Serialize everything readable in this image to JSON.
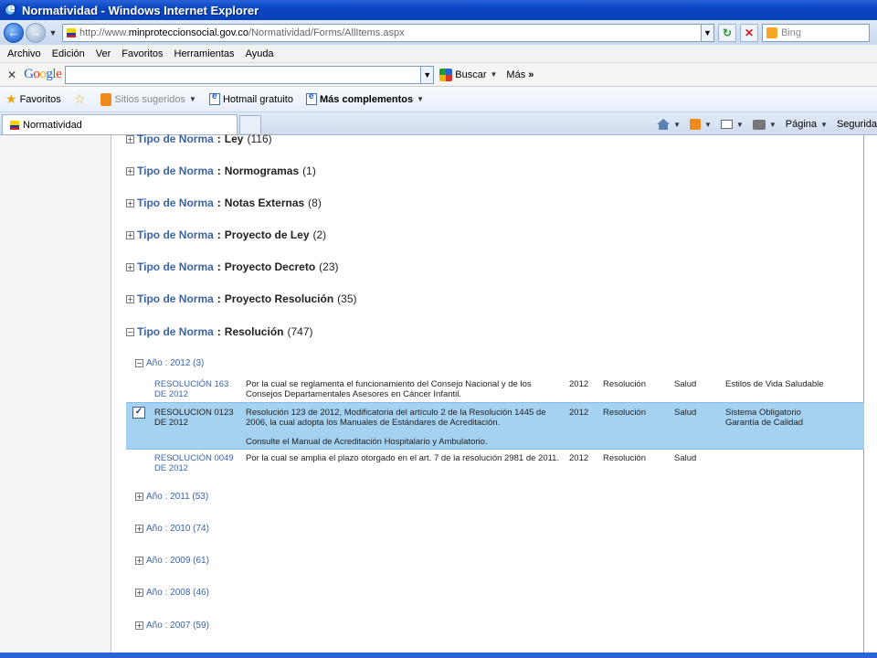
{
  "window": {
    "title": "Normatividad - Windows Internet Explorer"
  },
  "address": {
    "prefix": "http://www.",
    "domain": "minproteccionsocial.gov.co",
    "path": "/Normatividad/Forms/AllItems.aspx",
    "search_placeholder": "Bing"
  },
  "menu": [
    "Archivo",
    "Edición",
    "Ver",
    "Favoritos",
    "Herramientas",
    "Ayuda"
  ],
  "google_bar": {
    "close": "✕",
    "buscar": "Buscar",
    "mas": "Más"
  },
  "favorites": {
    "favoritos": "Favoritos",
    "sugeridos": "Sitios sugeridos",
    "hotmail": "Hotmail gratuito",
    "complementos": "Más complementos"
  },
  "tab": {
    "label": "Normatividad"
  },
  "commands": {
    "pagina": "Página",
    "seguridad": "Segurida"
  },
  "groups": [
    {
      "key": "Tipo de Norma",
      "value": "Ley",
      "count": "(116)",
      "expanded": false
    },
    {
      "key": "Tipo de Norma",
      "value": "Normogramas",
      "count": "(1)",
      "expanded": false
    },
    {
      "key": "Tipo de Norma",
      "value": "Notas Externas",
      "count": "(8)",
      "expanded": false
    },
    {
      "key": "Tipo de Norma",
      "value": "Proyecto de Ley",
      "count": "(2)",
      "expanded": false
    },
    {
      "key": "Tipo de Norma",
      "value": "Proyecto Decreto",
      "count": "(23)",
      "expanded": false
    },
    {
      "key": "Tipo de Norma",
      "value": "Proyecto Resolución",
      "count": "(35)",
      "expanded": false
    },
    {
      "key": "Tipo de Norma",
      "value": "Resolución",
      "count": "(747)",
      "expanded": true
    }
  ],
  "year_groups": [
    {
      "label": "Año : 2012 (3)",
      "expanded": true
    },
    {
      "label": "Año : 2011 (53)",
      "expanded": false
    },
    {
      "label": "Año : 2010 (74)",
      "expanded": false
    },
    {
      "label": "Año : 2009 (61)",
      "expanded": false
    },
    {
      "label": "Año : 2008 (46)",
      "expanded": false
    },
    {
      "label": "Año : 2007 (59)",
      "expanded": false
    }
  ],
  "rows": [
    {
      "title_1": "RESOLUCIÓN 163",
      "title_2": "DE 2012",
      "desc_1": "Por la cual se reglamenta el funcionamiento del Consejo Nacional y de los",
      "desc_2": "Consejos Departamentales Asesores en Cáncer Infantil.",
      "desc_3": "",
      "year": "2012",
      "type": "Resolución",
      "area": "Salud",
      "topic_1": "Estilos de Vida Saludable",
      "topic_2": "",
      "selected": false
    },
    {
      "title_1": "RESOLUCION 0123",
      "title_2": "DE 2012",
      "desc_1": "Resolución 123 de 2012, Modificatoria  del artículo 2 de la Resolución 1445 de",
      "desc_2": "2006, la cual adopta los Manuales de Estándares de Acreditación.",
      "desc_3": "Consulte el Manual de Acreditación Hospitalario y Ambulatorio.",
      "year": "2012",
      "type": "Resolución",
      "area": "Salud",
      "topic_1": "Sistema Obligatorio",
      "topic_2": "Garantía de Calidad",
      "selected": true
    },
    {
      "title_1": "RESOLUCIÓN 0049",
      "title_2": "DE 2012",
      "desc_1": "Por la cual se amplia el plazo otorgado en el art. 7 de la resolución 2981 de 2011.",
      "desc_2": "",
      "desc_3": "",
      "year": "2012",
      "type": "Resolución",
      "area": "Salud",
      "topic_1": "",
      "topic_2": "",
      "selected": false
    }
  ]
}
